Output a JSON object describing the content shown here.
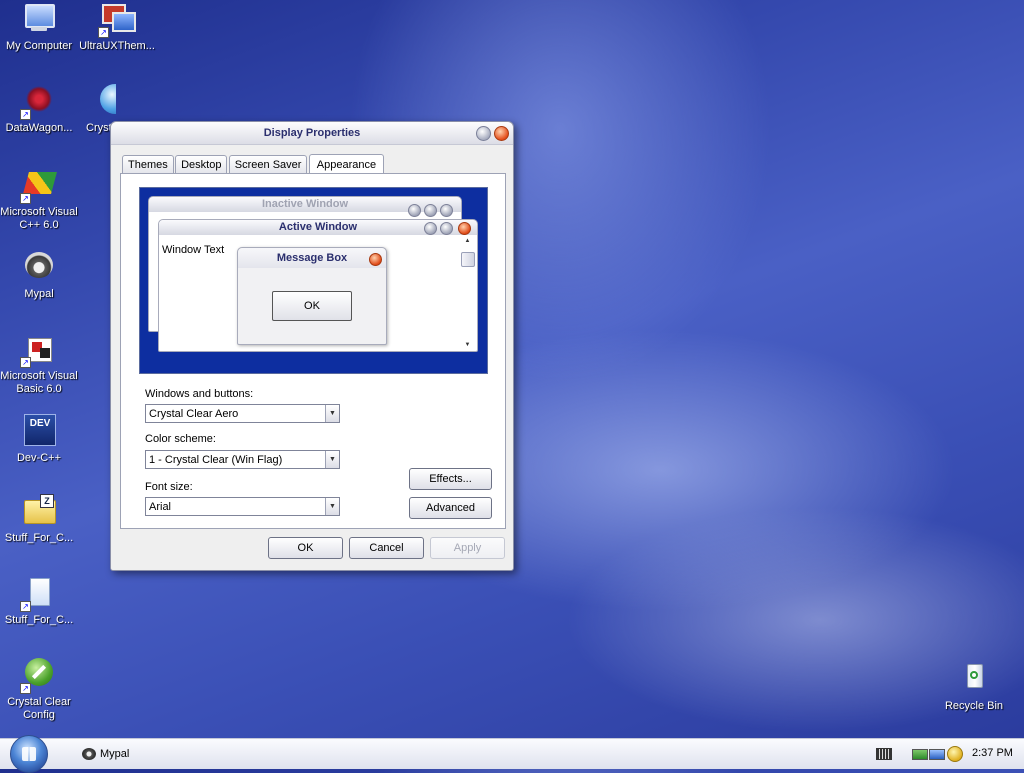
{
  "desktop": {
    "icons": [
      {
        "label": "My Computer",
        "icon": "computer-icon"
      },
      {
        "label": "UltraUXThem...",
        "icon": "network-computer-icon"
      },
      {
        "label": "DataWagon...",
        "icon": "datawagon-icon"
      },
      {
        "label": "Cryst...",
        "icon": "globe-icon"
      },
      {
        "label": "Microsoft Visual C++ 6.0",
        "icon": "visual-cpp-icon"
      },
      {
        "label": "Mypal",
        "icon": "mypal-icon"
      },
      {
        "label": "Microsoft Visual Basic 6.0",
        "icon": "visual-basic-icon"
      },
      {
        "label": "Dev-C++",
        "icon": "devcpp-icon"
      },
      {
        "label": "Stuff_For_C...",
        "icon": "zip-folder-icon"
      },
      {
        "label": "Stuff_For_C...",
        "icon": "document-icon"
      },
      {
        "label": "Crystal Clear Config",
        "icon": "config-icon"
      },
      {
        "label": "Recycle Bin",
        "icon": "recycle-bin-icon"
      }
    ]
  },
  "dialog": {
    "title": "Display Properties",
    "tabs": [
      "Themes",
      "Desktop",
      "Screen Saver",
      "Appearance"
    ],
    "active_tab": "Appearance",
    "preview": {
      "inactive_title": "Inactive Window",
      "active_title": "Active Window",
      "window_text": "Window Text",
      "message_box_title": "Message Box",
      "ok_label": "OK"
    },
    "windows_buttons_label": "Windows and buttons:",
    "windows_buttons_value": "Crystal Clear Aero",
    "color_scheme_label": "Color scheme:",
    "color_scheme_value": "1 - Crystal Clear (Win Flag)",
    "font_size_label": "Font size:",
    "font_size_value": "Arial",
    "effects_label": "Effects...",
    "advanced_label": "Advanced",
    "ok_label": "OK",
    "cancel_label": "Cancel",
    "apply_label": "Apply"
  },
  "taskbar": {
    "task_label": "Mypal",
    "clock": "2:37 PM"
  },
  "colors": {
    "desktop_blue": "#3448ad",
    "close_orange": "#e44c19",
    "title_text": "#2b2f6e"
  }
}
